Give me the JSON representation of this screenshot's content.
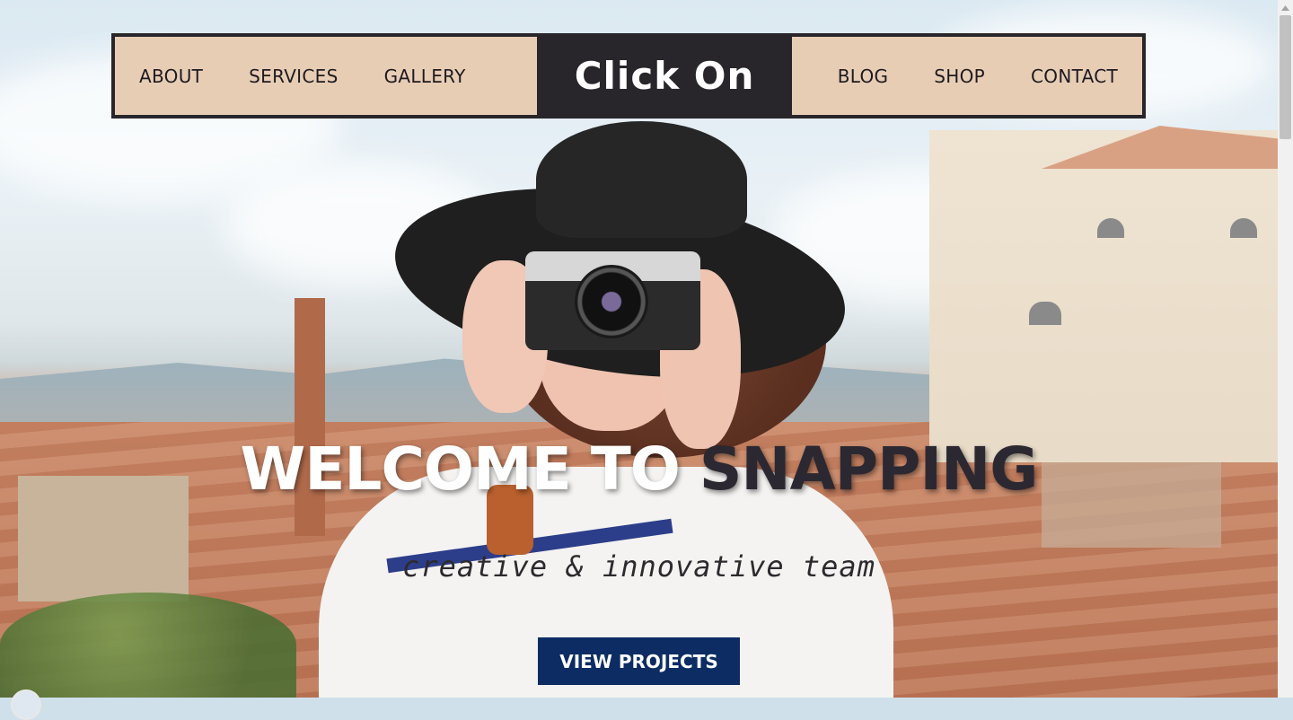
{
  "nav": {
    "left_items": [
      "ABOUT",
      "SERVICES",
      "GALLERY"
    ],
    "right_items": [
      "BLOG",
      "SHOP",
      "CONTACT"
    ],
    "logo": "Click On"
  },
  "hero": {
    "headline_part1": "WELCOME TO",
    "headline_part2": "SNAPPING",
    "tagline": "creative & innovative team",
    "cta_label": "VIEW PROJECTS"
  },
  "colors": {
    "nav_bg": "#e8cdb5",
    "logo_bg": "#28262b",
    "cta_bg": "#0c2c63",
    "accent_text": "#2c2831"
  },
  "icons": [
    "scroll-up-arrow-icon"
  ]
}
